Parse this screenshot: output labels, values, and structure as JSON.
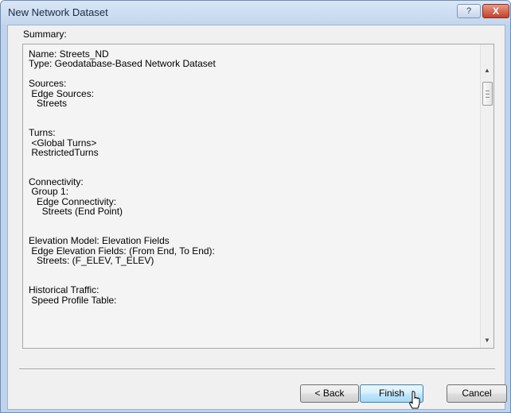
{
  "window": {
    "title": "New Network Dataset",
    "help_glyph": "?",
    "close_glyph": "X"
  },
  "summary": {
    "label": "Summary:",
    "blocks": [
      [
        "Name: Streets_ND",
        "Type: Geodatabase-Based Network Dataset"
      ],
      [
        "Sources:",
        " Edge Sources:",
        "   Streets"
      ],
      [
        "Turns:",
        " <Global Turns>",
        " RestrictedTurns"
      ],
      [
        "Connectivity:",
        " Group 1:",
        "   Edge Connectivity:",
        "     Streets (End Point)"
      ],
      [
        "Elevation Model: Elevation Fields",
        " Edge Elevation Fields: (From End, To End):",
        "   Streets: (F_ELEV, T_ELEV)"
      ],
      [
        "Historical Traffic:",
        " Speed Profile Table:"
      ]
    ]
  },
  "scrollbar": {
    "up_glyph": "▲",
    "down_glyph": "▼"
  },
  "buttons": {
    "back": "< Back",
    "finish": "Finish",
    "cancel": "Cancel"
  }
}
